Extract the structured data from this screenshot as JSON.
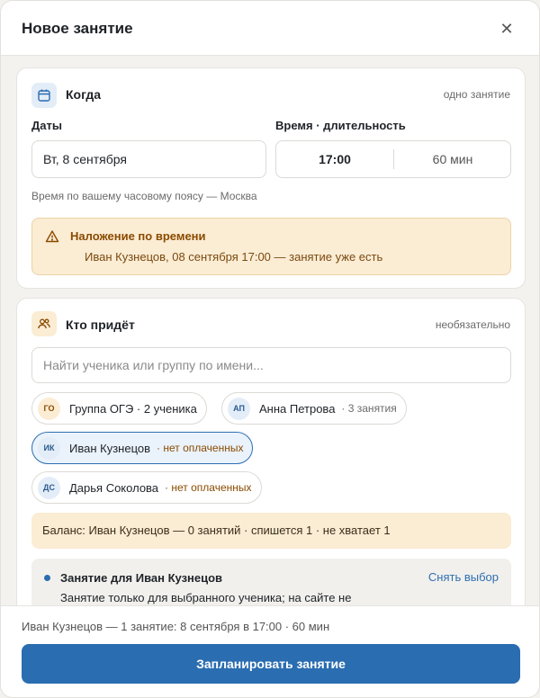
{
  "header": {
    "title": "Новое занятие",
    "close_icon": "close-icon"
  },
  "when": {
    "title": "Когда",
    "hint": "одно занятие",
    "icon": "calendar-icon",
    "dates_label": "Даты",
    "date_value": "Вт, 8 сентября",
    "time_label": "Время · длительность",
    "time_value": "17:00",
    "duration_value": "60 мин",
    "tz_note": "Время по вашему часовому поясу — Москва",
    "warning": {
      "icon": "warning-icon",
      "title": "Наложение по времени",
      "text": "Иван Кузнецов, 08 сентября 17:00 — занятие уже есть"
    }
  },
  "who": {
    "title": "Кто придёт",
    "hint": "необязательно",
    "icon": "users-icon",
    "search_placeholder": "Найти ученика или группу по имени...",
    "chips": [
      {
        "initials": "ГО",
        "name": "Группа ОГЭ · 2 ученика",
        "meta": ""
      },
      {
        "initials": "АП",
        "name": "Анна Петрова",
        "meta": "· 3 занятия"
      },
      {
        "initials": "ИК",
        "name": "Иван Кузнецов",
        "meta": "· нет оплаченных",
        "selected": true
      },
      {
        "initials": "ДС",
        "name": "Дарья Соколова",
        "meta": "· нет оплаченных"
      }
    ],
    "balance": "Баланс: Иван Кузнецов — 0 занятий · спишется 1 · не хватает 1",
    "lesson": {
      "title": "Занятие для Иван Кузнецов",
      "clear": "Снять выбор",
      "text": "Занятие только для выбранного ученика; на сайте не"
    }
  },
  "footer": {
    "summary": "Иван Кузнецов — 1 занятие: 8 сентября в 17:00 · 60 мин",
    "submit": "Запланировать занятие"
  },
  "colors": {
    "accent": "#2a6db1",
    "warning_bg": "#fbecd4",
    "warning_text": "#8a4b00"
  }
}
